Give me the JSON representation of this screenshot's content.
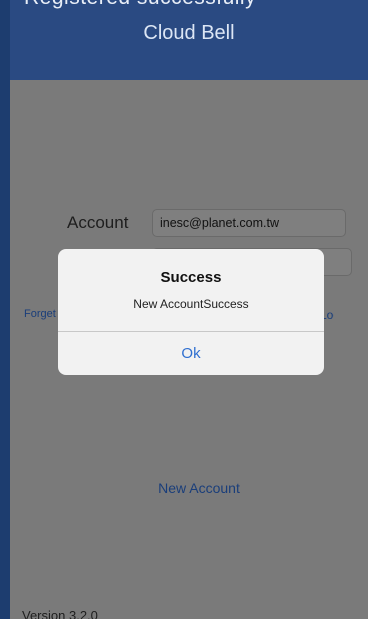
{
  "status_caption": "Registered successfully",
  "nav": {
    "title": "Cloud Bell"
  },
  "login": {
    "account_label": "Account",
    "account_value": "inesc@planet.com.tw",
    "password_value": "",
    "forget_link": "Forget",
    "right_link": "Login"
  },
  "new_account_link": "New Account",
  "version": "Version 3.2.0",
  "alert": {
    "title": "Success",
    "message": "New AccountSuccess",
    "ok_label": "Ok"
  },
  "colors": {
    "navbar": "#2a4a82",
    "overlay_content": "#7a7a7a",
    "link": "#1a3e7a",
    "alert_button": "#2f6fd0"
  }
}
